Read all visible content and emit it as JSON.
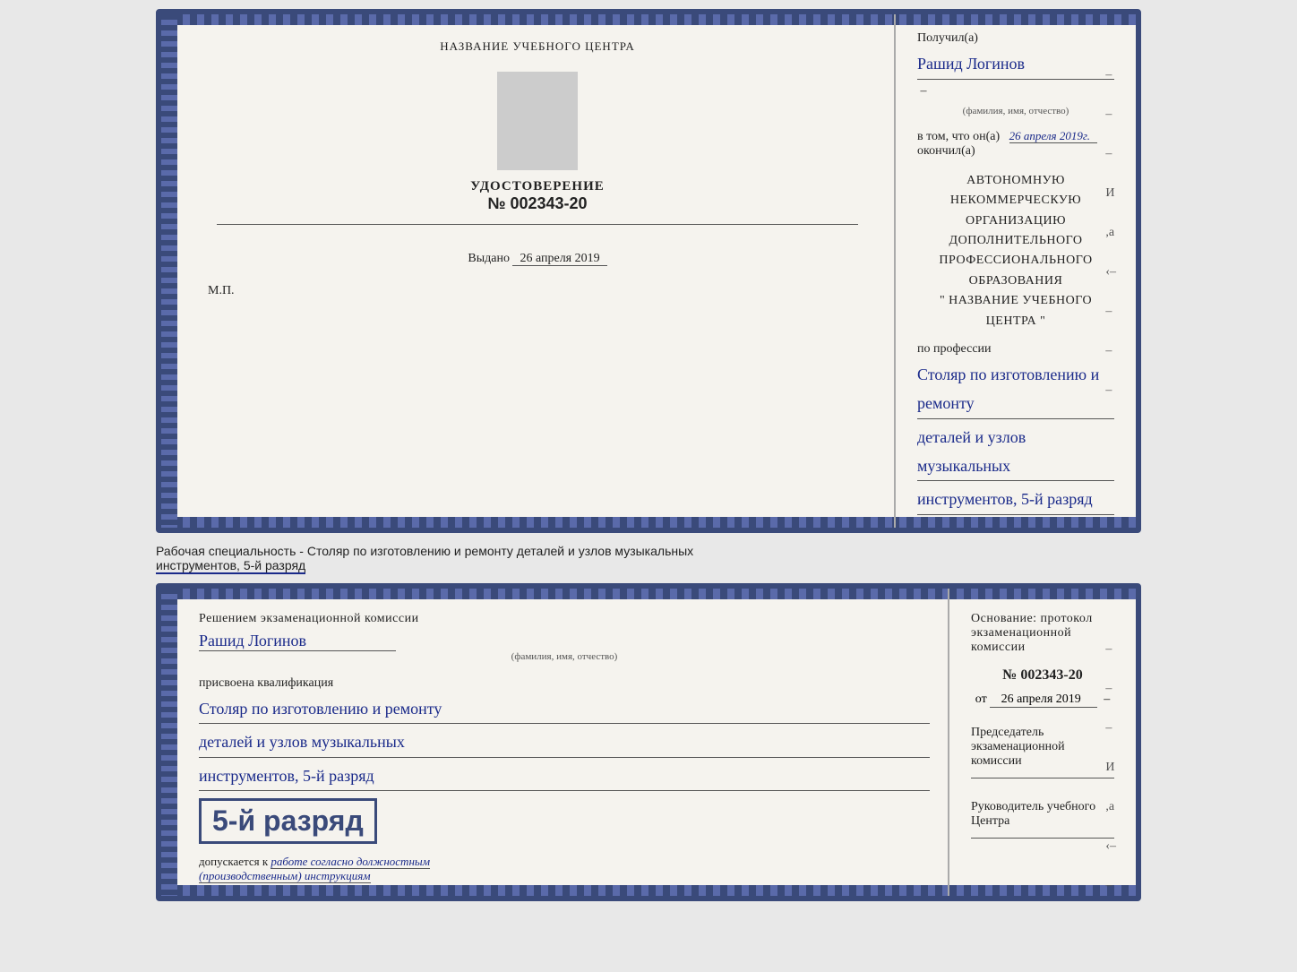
{
  "card1": {
    "left": {
      "center_title": "НАЗВАНИЕ УЧЕБНОГО ЦЕНТРА",
      "udost_label": "УДОСТОВЕРЕНИЕ",
      "udost_number": "№ 002343-20",
      "vydano_label": "Выдано",
      "vydano_date": "26 апреля 2019",
      "mp": "М.П."
    },
    "right": {
      "poluchil_prefix": "Получил(а)",
      "recipient_name": "Рашид Логинов",
      "fio_subtitle": "(фамилия, имя, отчество)",
      "vtom_prefix": "в том, что он(а)",
      "vtom_date": "26 апреля 2019г.",
      "okonchil": "окончил(а)",
      "org_line1": "АВТОНОМНУЮ НЕКОММЕРЧЕСКУЮ ОРГАНИЗАЦИЮ",
      "org_line2": "ДОПОЛНИТЕЛЬНОГО ПРОФЕССИОНАЛЬНОГО ОБРАЗОВАНИЯ",
      "org_line3": "\"  НАЗВАНИЕ УЧЕБНОГО ЦЕНТРА  \"",
      "po_professii": "по профессии",
      "profession_line1": "Столяр по изготовлению и ремонту",
      "profession_line2": "деталей и узлов музыкальных",
      "profession_line3": "инструментов, 5-й разряд"
    }
  },
  "specialty_text": {
    "prefix": "Рабочая специальность - Столяр по изготовлению и ремонту деталей и узлов музыкальных",
    "underlined": "инструментов, 5-й разряд"
  },
  "card2": {
    "left": {
      "reshenie_label": "Решением экзаменационной комиссии",
      "recipient_name": "Рашид Логинов",
      "fio_subtitle": "(фамилия, имя, отчество)",
      "prisvoena": "присвоена квалификация",
      "profession_line1": "Столяр по изготовлению и ремонту",
      "profession_line2": "деталей и узлов музыкальных",
      "profession_line3": "инструментов, 5-й разряд",
      "rank_text": "5-й разряд",
      "dopuskaetsya_prefix": "допускается к",
      "dopuskaetsya_italic": "работе согласно должностным",
      "dopuskaetsya_italic2": "(производственным) инструкциям"
    },
    "right": {
      "osnovanie_label": "Основание: протокол экзаменационной комиссии",
      "protocol_number": "№  002343-20",
      "ot_label": "от",
      "ot_date": "26 апреля 2019",
      "predsed_label": "Председатель экзаменационной",
      "predsed_label2": "комиссии",
      "ruk_label": "Руководитель учебного",
      "ruk_label2": "Центра"
    }
  },
  "side_chars": {
    "chars": [
      "–",
      "–",
      "И",
      ",а",
      "‹–",
      "–",
      "–",
      "–",
      "–"
    ]
  }
}
